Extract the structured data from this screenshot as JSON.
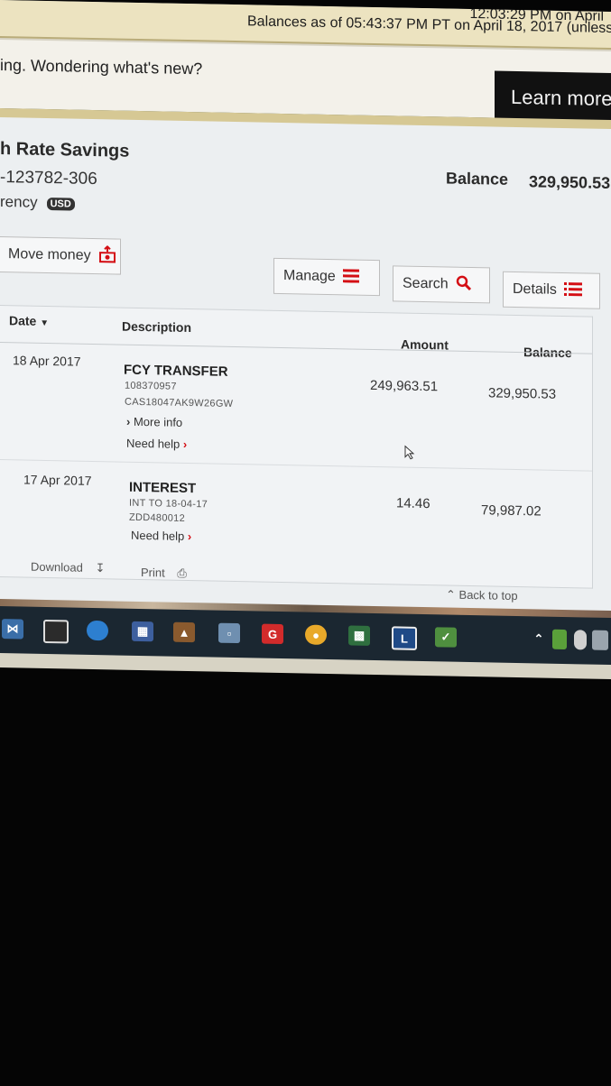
{
  "status_bar": {
    "logged_in_text": "12:03:29 PM on April",
    "balances_as_of": "Balances as of 05:43:37 PM PT on April 18, 2017 (unless"
  },
  "promo": {
    "text": "ing. Wondering what's new?",
    "learn_more": "Learn more"
  },
  "account": {
    "name": "h Rate Savings",
    "number": "-123782-306",
    "currency_label": "rency",
    "currency_badge": "USD",
    "balance_label": "Balance",
    "balance_value": "329,950.53"
  },
  "actions": {
    "move_money": "Move money",
    "manage": "Manage",
    "search": "Search",
    "details": "Details"
  },
  "table": {
    "headers": {
      "date": "Date",
      "description": "Description",
      "amount": "Amount",
      "balance": "Balance"
    },
    "rows": [
      {
        "date": "18 Apr 2017",
        "title": "FCY TRANSFER",
        "ref1": "108370957",
        "ref2": "CAS18047AK9W26GW",
        "more_info": "More info",
        "need_help": "Need help",
        "amount": "249,963.51",
        "balance": "329,950.53"
      },
      {
        "date": "17 Apr 2017",
        "title": "INTEREST",
        "ref1": "INT TO 18-04-17",
        "ref2": "ZDD480012",
        "need_help": "Need help",
        "amount": "14.46",
        "balance": "79,987.02"
      }
    ]
  },
  "footer": {
    "download": "Download",
    "print": "Print",
    "back_to_top": "Back to top"
  },
  "colors": {
    "brand_red": "#d40e14",
    "promo_button": "#111111",
    "taskbar": "#1b2731"
  }
}
